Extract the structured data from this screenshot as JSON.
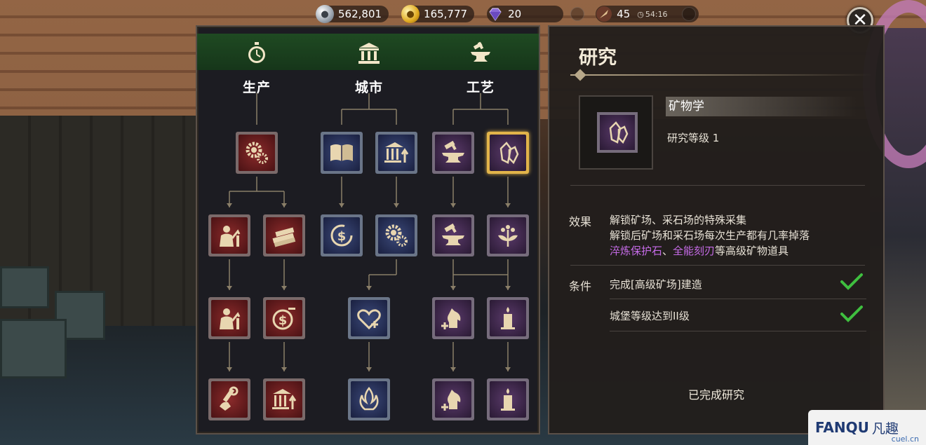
{
  "topbar": {
    "silver": "562,801",
    "gold": "165,777",
    "gems": "20",
    "energy": "45",
    "timer": "54:16"
  },
  "tree": {
    "categories": [
      {
        "label": "生产",
        "icon": "stopwatch-icon"
      },
      {
        "label": "城市",
        "icon": "building-columns-icon"
      },
      {
        "label": "工艺",
        "icon": "anvil-icon"
      }
    ]
  },
  "detail": {
    "title": "研究",
    "research_name": "矿物学",
    "research_level": "研究等级 1",
    "effect_label": "效果",
    "effect_line1": "解锁矿场、采石场的特殊采集",
    "effect_line2": "解锁后矿场和采石场每次生产都有几率掉落",
    "effect_item1": "淬炼保护石",
    "effect_sep": "、",
    "effect_item2": "全能刻刃",
    "effect_line3_tail": "等高级矿物道具",
    "condition_label": "条件",
    "condition1": "完成[高级矿场]建造",
    "condition2": "城堡等级达到II级",
    "status": "已完成研究"
  },
  "colors": {
    "highlight": "#c66be8",
    "check": "#3fbf3f",
    "selected_border": "#e2b44a"
  },
  "watermark": {
    "brand": "FANQU",
    "cn": "凡趣",
    "domain": "cuel.cn"
  }
}
